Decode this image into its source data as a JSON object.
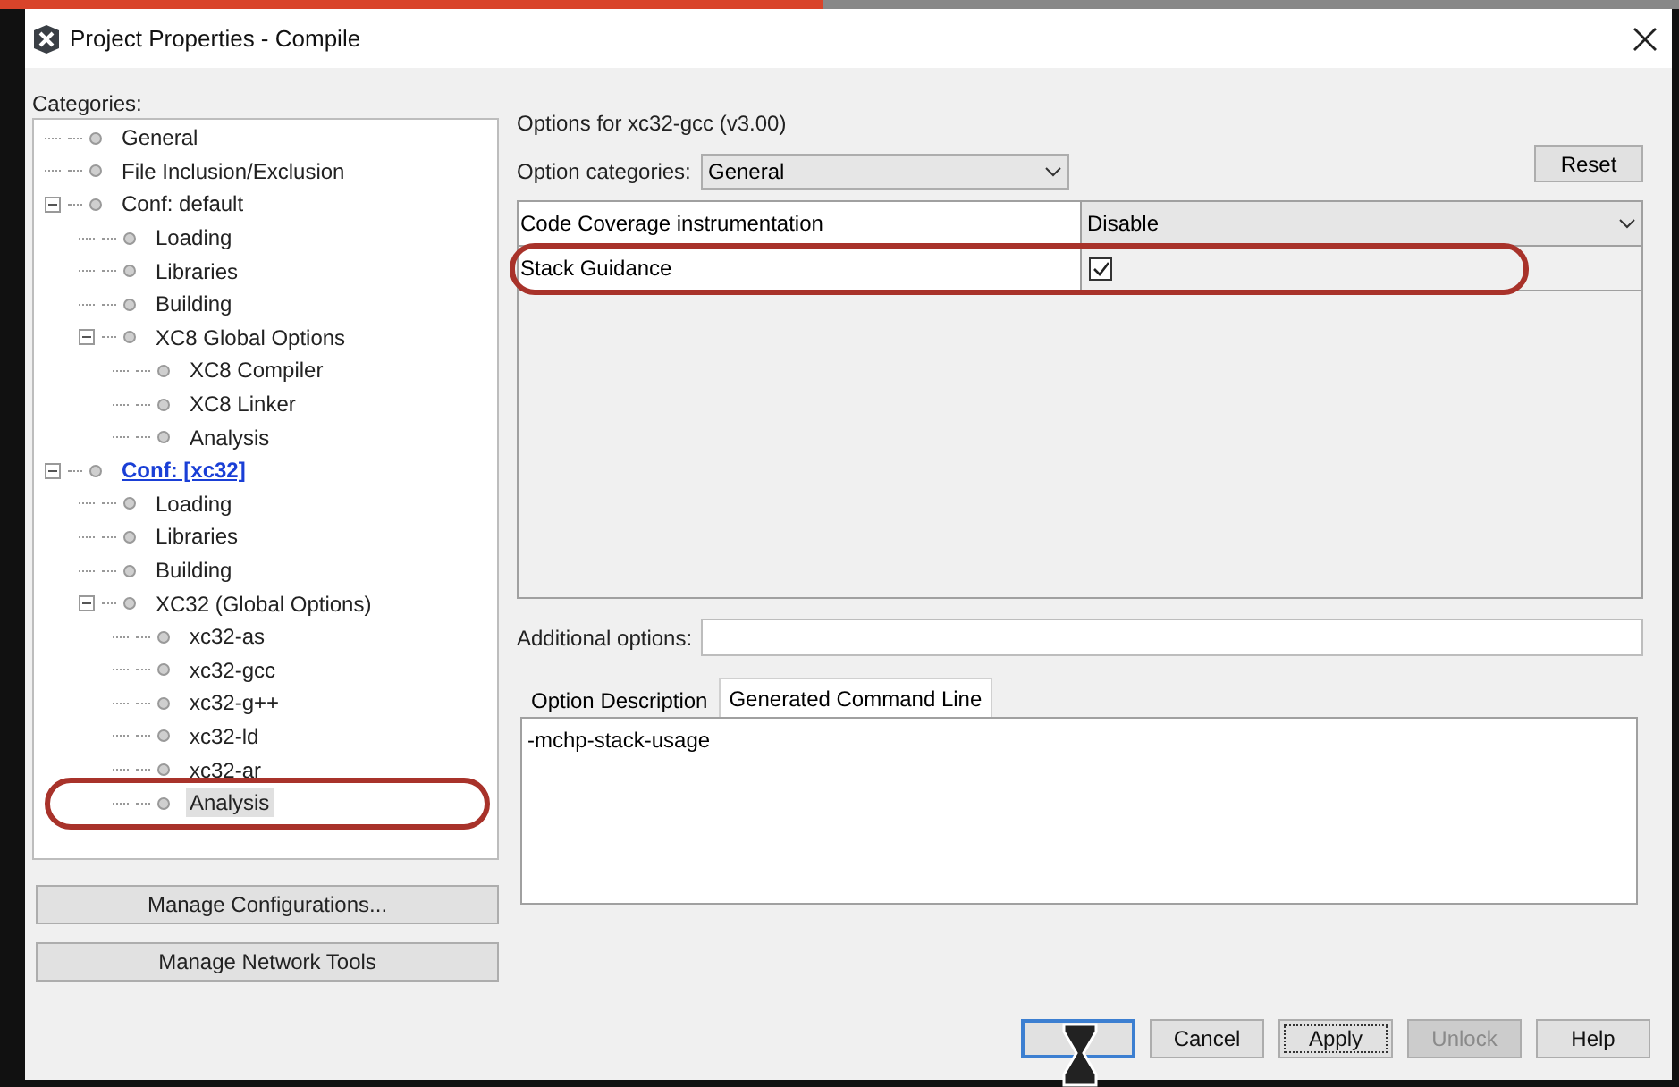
{
  "window": {
    "title": "Project Properties - Compile"
  },
  "categories": {
    "label": "Categories:",
    "tree": [
      {
        "label": "General",
        "selected": false,
        "active": false,
        "highlighted": false
      },
      {
        "label": "File Inclusion/Exclusion",
        "selected": false,
        "active": false,
        "highlighted": false
      },
      {
        "label": "Conf: default",
        "selected": false,
        "active": false,
        "highlighted": false,
        "expanded": true,
        "children": [
          {
            "label": "Loading",
            "selected": false,
            "active": false,
            "highlighted": false
          },
          {
            "label": "Libraries",
            "selected": false,
            "active": false,
            "highlighted": false
          },
          {
            "label": "Building",
            "selected": false,
            "active": false,
            "highlighted": false
          },
          {
            "label": "XC8 Global Options",
            "selected": false,
            "active": false,
            "highlighted": false,
            "expanded": true,
            "children": [
              {
                "label": "XC8 Compiler",
                "selected": false,
                "active": false,
                "highlighted": false
              },
              {
                "label": "XC8 Linker",
                "selected": false,
                "active": false,
                "highlighted": false
              },
              {
                "label": "Analysis",
                "selected": false,
                "active": false,
                "highlighted": false
              }
            ]
          }
        ]
      },
      {
        "label": "Conf: [xc32]",
        "selected": false,
        "active": true,
        "highlighted": false,
        "expanded": true,
        "children": [
          {
            "label": "Loading",
            "selected": false,
            "active": false,
            "highlighted": false
          },
          {
            "label": "Libraries",
            "selected": false,
            "active": false,
            "highlighted": false
          },
          {
            "label": "Building",
            "selected": false,
            "active": false,
            "highlighted": false
          },
          {
            "label": "XC32 (Global Options)",
            "selected": false,
            "active": false,
            "highlighted": false,
            "expanded": true,
            "children": [
              {
                "label": "xc32-as",
                "selected": false,
                "active": false,
                "highlighted": false
              },
              {
                "label": "xc32-gcc",
                "selected": false,
                "active": false,
                "highlighted": false
              },
              {
                "label": "xc32-g++",
                "selected": false,
                "active": false,
                "highlighted": false
              },
              {
                "label": "xc32-ld",
                "selected": false,
                "active": false,
                "highlighted": false
              },
              {
                "label": "xc32-ar",
                "selected": false,
                "active": false,
                "highlighted": false
              },
              {
                "label": "Analysis",
                "selected": true,
                "active": false,
                "highlighted": true
              }
            ]
          }
        ]
      }
    ]
  },
  "side_buttons": [
    "Manage Configurations...",
    "Manage Network Tools"
  ],
  "options_title": "Options for xc32-gcc (v3.00)",
  "option_categories": {
    "label": "Option categories:",
    "value": "General"
  },
  "reset_button": "Reset",
  "options_table": [
    {
      "name": "Code Coverage instrumentation",
      "kind": "dropdown",
      "value": "Disable",
      "highlighted": false
    },
    {
      "name": "Stack Guidance",
      "kind": "checkbox",
      "checked": true,
      "highlighted": true
    }
  ],
  "additional_options": {
    "label": "Additional options:"
  },
  "tabs": [
    {
      "label": "Option Description",
      "selected": false
    },
    {
      "label": "Generated Command Line",
      "selected": true
    }
  ],
  "command_line": "-mchp-stack-usage",
  "buttons": [
    {
      "default": true,
      "focused": false,
      "disabled": false,
      "cursor": true
    },
    {
      "label": "Cancel",
      "default": false,
      "focused": false,
      "disabled": false,
      "cursor": false
    },
    {
      "label": "Apply",
      "default": false,
      "focused": true,
      "disabled": false,
      "cursor": false
    },
    {
      "label": "Unlock",
      "default": false,
      "focused": false,
      "disabled": true,
      "cursor": false
    },
    {
      "label": "Help",
      "default": false,
      "focused": false,
      "disabled": false,
      "cursor": false
    }
  ]
}
